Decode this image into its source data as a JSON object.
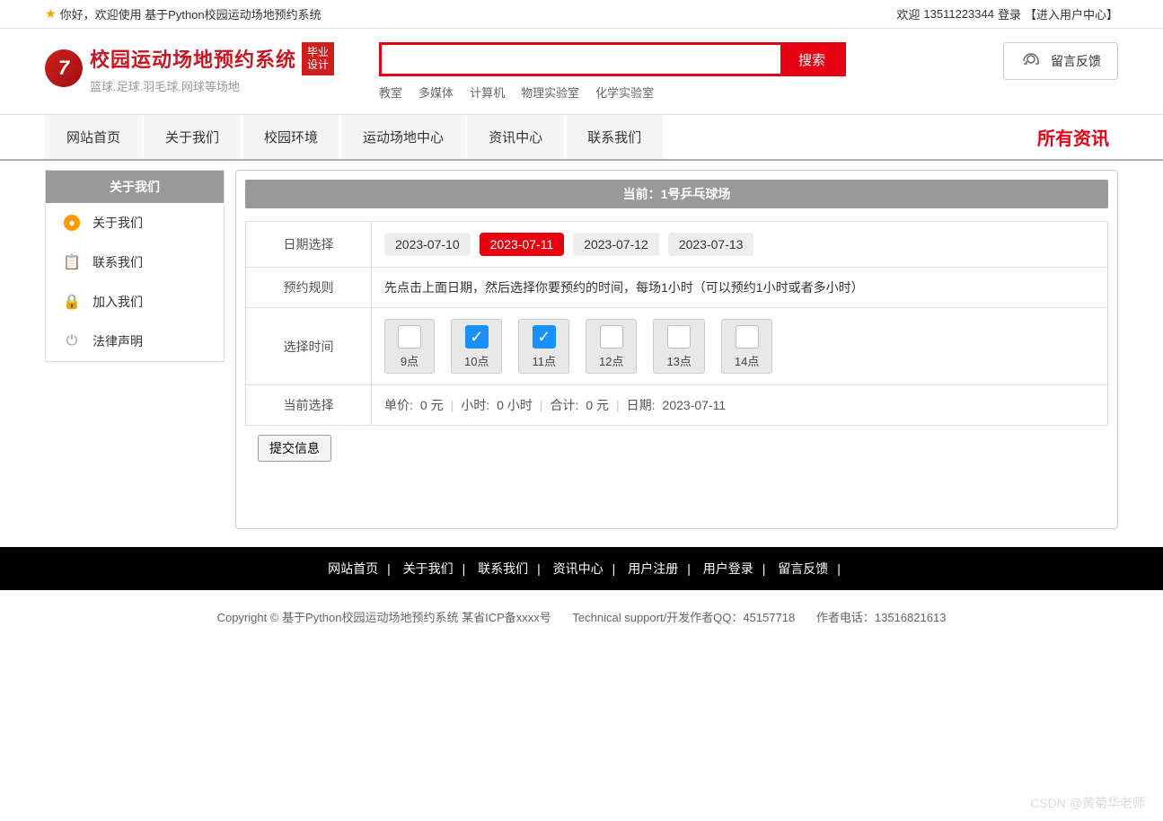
{
  "topbar": {
    "greeting": "你好，欢迎使用 基于Python校园运动场地预约系统",
    "welcome": "欢迎",
    "user": "13511223344",
    "login": "登录",
    "usercenter": "【进入用户中心】"
  },
  "logo": {
    "title": "校园运动场地预约系统",
    "badge": "毕业设计",
    "subtitle": "篮球.足球.羽毛球.网球等场地"
  },
  "search": {
    "button": "搜索",
    "tags": [
      "教室",
      "多媒体",
      "计算机",
      "物理实验室",
      "化学实验室"
    ]
  },
  "feedback": {
    "label": "留言反馈"
  },
  "nav": {
    "items": [
      "网站首页",
      "关于我们",
      "校园环境",
      "运动场地中心",
      "资讯中心",
      "联系我们"
    ],
    "right": "所有资讯"
  },
  "sidebar": {
    "title": "关于我们",
    "items": [
      {
        "label": "关于我们"
      },
      {
        "label": "联系我们"
      },
      {
        "label": "加入我们"
      },
      {
        "label": "法律声明"
      }
    ]
  },
  "content": {
    "title": "当前：1号乒乓球场",
    "labels": {
      "date": "日期选择",
      "rule": "预约规则",
      "time": "选择时间",
      "current": "当前选择"
    },
    "dates": [
      {
        "text": "2023-07-10",
        "active": false
      },
      {
        "text": "2023-07-11",
        "active": true
      },
      {
        "text": "2023-07-12",
        "active": false
      },
      {
        "text": "2023-07-13",
        "active": false
      }
    ],
    "rule_text": "先点击上面日期，然后选择你要预约的时间，每场1小时（可以预约1小时或者多小时）",
    "times": [
      {
        "label": "9点",
        "checked": false
      },
      {
        "label": "10点",
        "checked": true
      },
      {
        "label": "11点",
        "checked": true
      },
      {
        "label": "12点",
        "checked": false
      },
      {
        "label": "13点",
        "checked": false
      },
      {
        "label": "14点",
        "checked": false
      }
    ],
    "summary": {
      "price_label": "单价:",
      "price_value": "0 元",
      "hours_label": "小时:",
      "hours_value": "0 小时",
      "total_label": "合计:",
      "total_value": "0 元",
      "date_label": "日期:",
      "date_value": "2023-07-11"
    },
    "submit": "提交信息"
  },
  "footer": {
    "links": [
      "网站首页",
      "关于我们",
      "联系我们",
      "资讯中心",
      "用户注册",
      "用户登录",
      "留言反馈"
    ],
    "copyright": "Copyright © 基于Python校园运动场地预约系统 某省ICP备xxxx号",
    "tech": "Technical support/开发作者QQ：45157718",
    "phone": "作者电话：13516821613"
  },
  "watermark": "CSDN @黄菊华老师"
}
